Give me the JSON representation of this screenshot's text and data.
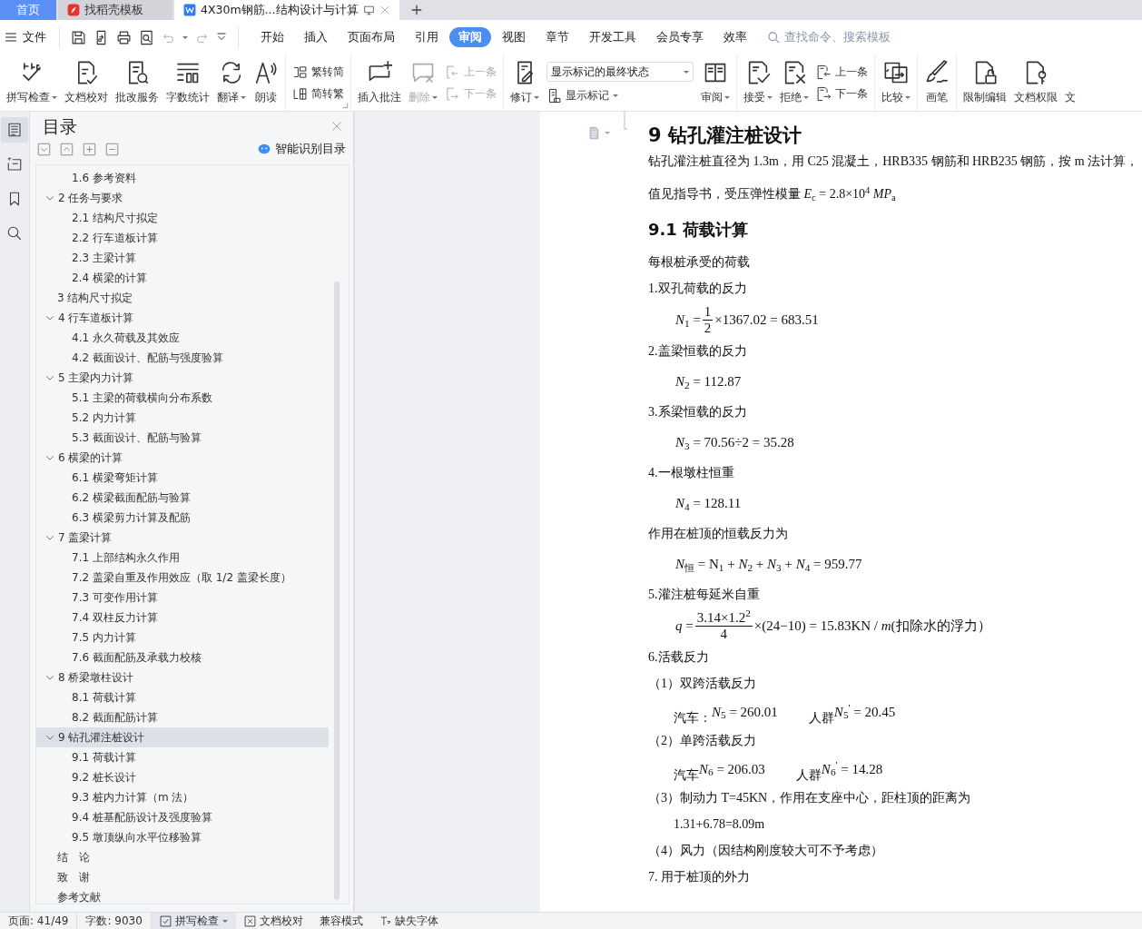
{
  "tabs": [
    {
      "label": "首页",
      "kind": "home",
      "selected": false
    },
    {
      "label": "找稻壳模板",
      "kind": "store",
      "selected": false
    },
    {
      "label": "4X30m钢筋...结构设计与计算",
      "kind": "doc",
      "selected": true
    }
  ],
  "menu": {
    "file": "文件"
  },
  "ribbon_tabs": [
    {
      "label": "开始",
      "selected": false
    },
    {
      "label": "插入",
      "selected": false
    },
    {
      "label": "页面布局",
      "selected": false
    },
    {
      "label": "引用",
      "selected": false
    },
    {
      "label": "审阅",
      "selected": true
    },
    {
      "label": "视图",
      "selected": false
    },
    {
      "label": "章节",
      "selected": false
    },
    {
      "label": "开发工具",
      "selected": false
    },
    {
      "label": "会员专享",
      "selected": false
    },
    {
      "label": "效率",
      "selected": false
    }
  ],
  "search": {
    "placeholder": "查找命令、搜索模板"
  },
  "ribbon": {
    "groups": [
      {
        "items": [
          {
            "kind": "big",
            "label": "拼写检查",
            "dropdown": true,
            "disabled": false
          },
          {
            "kind": "big",
            "label": "文档校对",
            "dropdown": false,
            "disabled": false
          },
          {
            "kind": "big",
            "label": "批改服务",
            "dropdown": false,
            "disabled": false
          },
          {
            "kind": "big",
            "label": "字数统计",
            "dropdown": false,
            "disabled": false
          },
          {
            "kind": "big",
            "label": "翻译",
            "dropdown": true,
            "disabled": false
          },
          {
            "kind": "big",
            "label": "朗读",
            "dropdown": false,
            "disabled": false
          }
        ]
      },
      {
        "items": [
          {
            "kind": "stack",
            "launcher": true,
            "items": [
              {
                "label": "繁转简",
                "disabled": false
              },
              {
                "label": "简转繁",
                "disabled": false
              }
            ]
          }
        ]
      },
      {
        "items": [
          {
            "kind": "big",
            "label": "插入批注",
            "dropdown": false,
            "disabled": false
          },
          {
            "kind": "big",
            "label": "删除",
            "dropdown": true,
            "disabled": true
          },
          {
            "kind": "stack",
            "launcher": false,
            "items": [
              {
                "label": "上一条",
                "disabled": true
              },
              {
                "label": "下一条",
                "disabled": true
              }
            ]
          }
        ]
      },
      {
        "items": [
          {
            "kind": "big",
            "label": "修订",
            "dropdown": true,
            "disabled": false
          },
          {
            "kind": "combo",
            "value": "显示标记的最终状态",
            "item": {
              "label": "显示标记",
              "dropdown": true
            }
          },
          {
            "kind": "big",
            "label": "审阅",
            "dropdown": true,
            "disabled": false
          }
        ]
      },
      {
        "items": [
          {
            "kind": "big",
            "label": "接受",
            "dropdown": true,
            "disabled": false
          },
          {
            "kind": "big",
            "label": "拒绝",
            "dropdown": true,
            "disabled": false
          },
          {
            "kind": "stack",
            "launcher": false,
            "items": [
              {
                "label": "上一条",
                "disabled": false
              },
              {
                "label": "下一条",
                "disabled": false
              }
            ]
          }
        ]
      },
      {
        "items": [
          {
            "kind": "big",
            "label": "比较",
            "dropdown": true,
            "disabled": false
          }
        ]
      },
      {
        "items": [
          {
            "kind": "big",
            "label": "画笔",
            "dropdown": false,
            "disabled": false
          }
        ]
      },
      {
        "items": [
          {
            "kind": "big",
            "label": "限制编辑",
            "dropdown": false,
            "disabled": false
          },
          {
            "kind": "big",
            "label": "文档权限",
            "dropdown": false,
            "disabled": false
          },
          {
            "kind": "label",
            "label": "文"
          }
        ]
      }
    ]
  },
  "toc": {
    "title": "目录",
    "smart_button": "智能识别目录",
    "partial_children": [
      "1.6 参考资料"
    ],
    "items": [
      {
        "text": "2 任务与要求",
        "expanded": true,
        "selected": false,
        "children": [
          {
            "text": "2.1 结构尺寸拟定",
            "selected": false
          },
          {
            "text": "2.2 行车道板计算",
            "selected": false
          },
          {
            "text": "2.3 主梁计算",
            "selected": false
          },
          {
            "text": "2.4 横梁的计算",
            "selected": false
          }
        ]
      },
      {
        "text": "3 结构尺寸拟定",
        "selected": false
      },
      {
        "text": "4 行车道板计算",
        "expanded": true,
        "selected": false,
        "children": [
          {
            "text": "4.1 永久荷载及其效应",
            "selected": false
          },
          {
            "text": "4.2 截面设计、配筋与强度验算",
            "selected": false
          }
        ]
      },
      {
        "text": "5 主梁内力计算",
        "expanded": true,
        "selected": false,
        "children": [
          {
            "text": "5.1 主梁的荷载横向分布系数",
            "selected": false
          },
          {
            "text": "5.2 内力计算",
            "selected": false
          },
          {
            "text": "5.3 截面设计、配筋与验算",
            "selected": false
          }
        ]
      },
      {
        "text": "6  横梁的计算",
        "expanded": true,
        "selected": false,
        "children": [
          {
            "text": "6.1 横梁弯矩计算",
            "selected": false
          },
          {
            "text": "6.2 横梁截面配筋与验算",
            "selected": false
          },
          {
            "text": "6.3 横梁剪力计算及配筋",
            "selected": false
          }
        ]
      },
      {
        "text": "7  盖梁计算",
        "expanded": true,
        "selected": false,
        "children": [
          {
            "text": "7.1 上部结构永久作用",
            "selected": false
          },
          {
            "text": "7.2 盖梁自重及作用效应（取 1/2 盖梁长度）",
            "selected": false
          },
          {
            "text": "7.3 可变作用计算",
            "selected": false
          },
          {
            "text": "7.4 双柱反力计算",
            "selected": false
          },
          {
            "text": "7.5 内力计算",
            "selected": false
          },
          {
            "text": "7.6 截面配筋及承载力校核",
            "selected": false
          }
        ]
      },
      {
        "text": "8  桥梁墩柱设计",
        "expanded": true,
        "selected": false,
        "children": [
          {
            "text": "8.1 荷载计算",
            "selected": false
          },
          {
            "text": "8.2 截面配筋计算",
            "selected": false
          }
        ]
      },
      {
        "text": "9  钻孔灌注桩设计",
        "expanded": true,
        "selected": true,
        "children": [
          {
            "text": "9.1 荷载计算",
            "selected": false
          },
          {
            "text": "9.2 桩长设计",
            "selected": false
          },
          {
            "text": "9.3 桩内力计算（m 法）",
            "selected": false
          },
          {
            "text": "9.4 桩基配筋设计及强度验算",
            "selected": false
          },
          {
            "text": "9.5 墩顶纵向水平位移验算",
            "selected": false
          }
        ]
      },
      {
        "text": "结　论",
        "selected": false
      },
      {
        "text": "致　谢",
        "selected": false
      },
      {
        "text": "参考文献",
        "selected": false
      }
    ]
  },
  "document": {
    "blocks": [
      {
        "kind": "h1",
        "text": "9  钻孔灌注桩设计"
      },
      {
        "kind": "p",
        "text": "钻孔灌注桩直径为 1.3m，用 C25 混凝土，HRB335 钢筋和 HRB235 钢筋，按 m 法计算，"
      },
      {
        "kind": "p",
        "text": "值见指导书，受压弹性模量 *E*$_{c}$ = 2.8×10$^{4}$ *MP*$_{a}$"
      },
      {
        "kind": "h2",
        "text": "9.1 荷载计算"
      },
      {
        "kind": "p",
        "text": "每根桩承受的荷载"
      },
      {
        "kind": "p",
        "text": "1.双孔荷载的反力"
      },
      {
        "kind": "frac",
        "lhs": "*N*$_{1}$ = ",
        "num": "1",
        "den": "2",
        "rhs": "×1367.02 = 683.51"
      },
      {
        "kind": "p",
        "text": "2.盖梁恒载的反力"
      },
      {
        "kind": "eq",
        "text": "*N*$_{2}$ = 112.87"
      },
      {
        "kind": "p",
        "text": "3.系梁恒载的反力"
      },
      {
        "kind": "eq",
        "text": "*N*$_{3}$ = 70.56÷2 = 35.28"
      },
      {
        "kind": "p",
        "text": "4.一根墩柱恒重"
      },
      {
        "kind": "eq",
        "text": "*N*$_{4}$ = 128.11"
      },
      {
        "kind": "p",
        "text": "作用在桩顶的恒载反力为"
      },
      {
        "kind": "eq",
        "text": "*N*$_{恒}$ = N$_{1}$ + *N*$_{2}$ + *N*$_{3}$ + *N*$_{4}$ = 959.77"
      },
      {
        "kind": "p",
        "text": "5.灌注桩每延米自重"
      },
      {
        "kind": "frac",
        "lhs": "*q* = ",
        "num": "3.14×1.2$^{2}$",
        "den": "4",
        "rhs": "×(24−10) = 15.83KN / *m*(扣除水的浮力）"
      },
      {
        "kind": "p",
        "text": "6.活载反力"
      },
      {
        "kind": "p",
        "text": "（1）双跨活载反力"
      },
      {
        "kind": "pair",
        "items": [
          {
            "label": "汽车：",
            "eq": "*N*$_{5}$ = 260.01"
          },
          {
            "label": "人群",
            "eq": "*N*$_{5}$$^{'}$ = 20.45"
          }
        ]
      },
      {
        "kind": "p",
        "text": "（2）单跨活载反力"
      },
      {
        "kind": "pair",
        "items": [
          {
            "label": "汽车",
            "eq": "*N*$_{6}$ = 206.03"
          },
          {
            "label": "人群",
            "eq": "*N*$_{6}$$^{'}$ = 14.28"
          }
        ]
      },
      {
        "kind": "p",
        "text": "（3）制动力 T=45KN，作用在支座中心，距柱顶的距离为"
      },
      {
        "kind": "indent",
        "text": "1.31+6.78=8.09m"
      },
      {
        "kind": "p",
        "text": "（4）风力（因结构刚度较大可不予考虑）"
      },
      {
        "kind": "p",
        "text": "7.  用于桩顶的外力"
      }
    ]
  },
  "status_bar": [
    {
      "kind": "info",
      "text": "页面: 41/49"
    },
    {
      "kind": "info",
      "text": "字数: 9030"
    },
    {
      "kind": "check",
      "text": "拼写检查",
      "checked": true
    },
    {
      "kind": "action",
      "text": "文档校对"
    },
    {
      "kind": "info",
      "text": "兼容模式"
    },
    {
      "kind": "font",
      "text": "缺失字体"
    }
  ]
}
